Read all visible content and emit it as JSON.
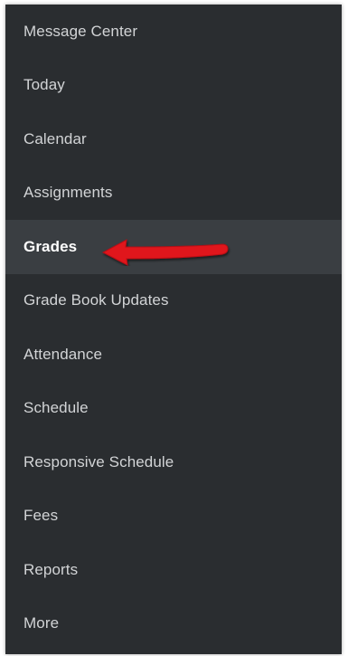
{
  "nav": {
    "items": [
      {
        "label": "Message Center"
      },
      {
        "label": "Today"
      },
      {
        "label": "Calendar"
      },
      {
        "label": "Assignments"
      },
      {
        "label": "Grades"
      },
      {
        "label": "Grade Book Updates"
      },
      {
        "label": "Attendance"
      },
      {
        "label": "Schedule"
      },
      {
        "label": "Responsive Schedule"
      },
      {
        "label": "Fees"
      },
      {
        "label": "Reports"
      },
      {
        "label": "More"
      }
    ],
    "active_index": 4
  },
  "annotation": {
    "icon": "red-arrow-icon",
    "color": "#e0141b"
  },
  "colors": {
    "background": "#2a2d30",
    "active_background": "#3a3e42",
    "text": "#d2d4d6",
    "active_text": "#ffffff"
  }
}
